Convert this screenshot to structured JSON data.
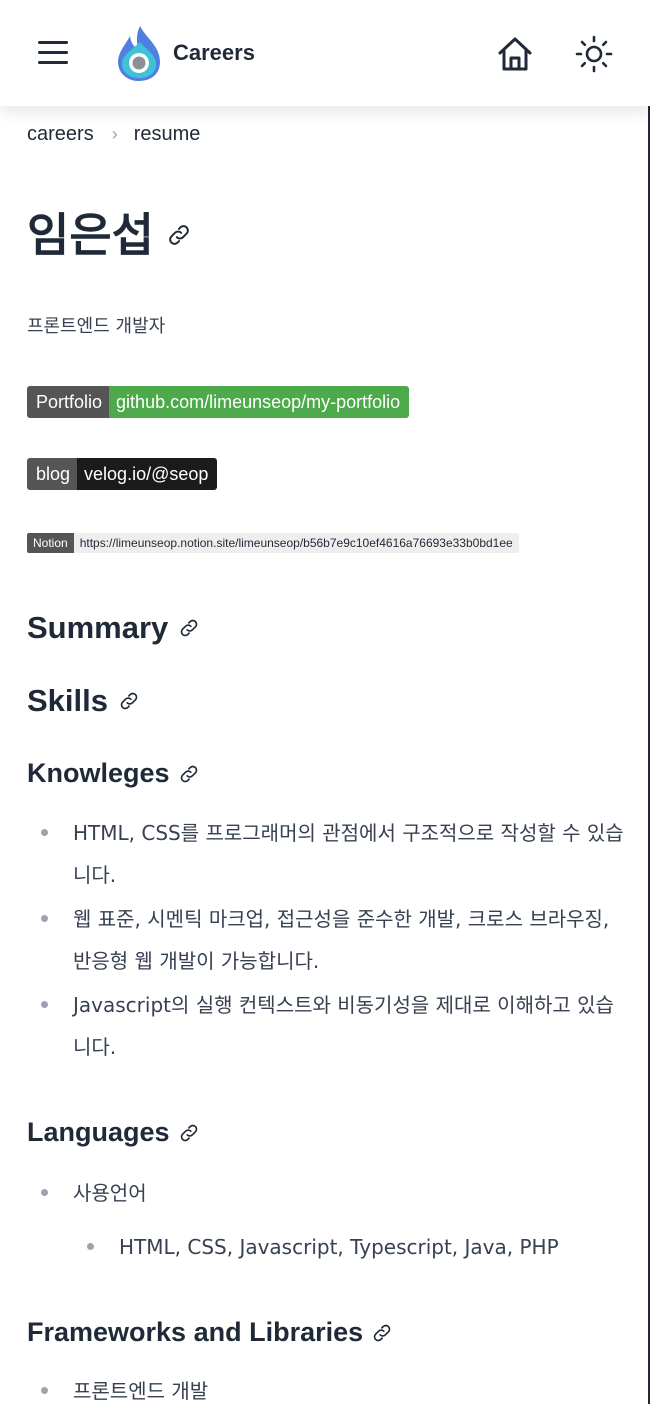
{
  "header": {
    "brand": "Careers",
    "menu_icon": "hamburger-menu-icon",
    "logo_icon": "flame-logo-icon",
    "home_icon": "home-icon",
    "theme_icon": "sun-icon",
    "colors": {
      "logo_blue": "#4f7fe0",
      "logo_teal": "#3fc2d8",
      "text": "#1f2937"
    }
  },
  "breadcrumb": {
    "items": [
      "careers",
      "resume"
    ]
  },
  "page": {
    "title": "임은섭",
    "subtitle": "프론트엔드 개발자"
  },
  "badges": {
    "portfolio": {
      "label": "Portfolio",
      "value": "github.com/limeunseop/my-portfolio",
      "color": "#4caa4a"
    },
    "blog": {
      "label": "blog",
      "value": "velog.io/@seop",
      "color": "#1b1b1b"
    },
    "notion": {
      "label": "Notion",
      "value": "https://limeunseop.notion.site/limeunseop/b56b7e9c10ef4616a76693e33b0bd1ee",
      "color": "#eeeeee"
    }
  },
  "sections": {
    "summary": "Summary",
    "skills": "Skills",
    "knowledges": {
      "title": "Knowleges",
      "items": [
        "HTML, CSS를 프로그래머의 관점에서 구조적으로 작성할 수 있습니다.",
        "웹 표준, 시멘틱 마크업, 접근성을 준수한 개발, 크로스 브라우징, 반응형 웹 개발이 가능합니다.",
        "Javascript의 실행 컨텍스트와 비동기성을 제대로 이해하고 있습니다."
      ]
    },
    "languages": {
      "title": "Languages",
      "item": "사용언어",
      "subitem": "HTML, CSS, Javascript, Typescript, Java, PHP"
    },
    "frameworks": {
      "title": "Frameworks and Libraries",
      "item": "프론트엔드 개발"
    }
  }
}
